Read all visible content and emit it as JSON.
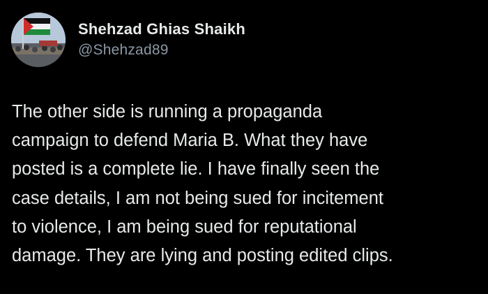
{
  "tweet": {
    "author": {
      "display_name": "Shehzad Ghias Shaikh",
      "handle": "@Shehzad89",
      "avatar_icon": "profile-photo-with-flag"
    },
    "text_lines": [
      "The other side is running a propaganda",
      "campaign to defend Maria B. What they have",
      "posted is a complete lie. I have finally seen the",
      "case details, I am not being sued for incitement",
      "to violence, I am being sued for reputational",
      "damage. They are lying and posting edited clips."
    ]
  },
  "colors": {
    "background": "#000000",
    "primary_text": "#e7e9ea",
    "secondary_text": "#8b98a5"
  }
}
